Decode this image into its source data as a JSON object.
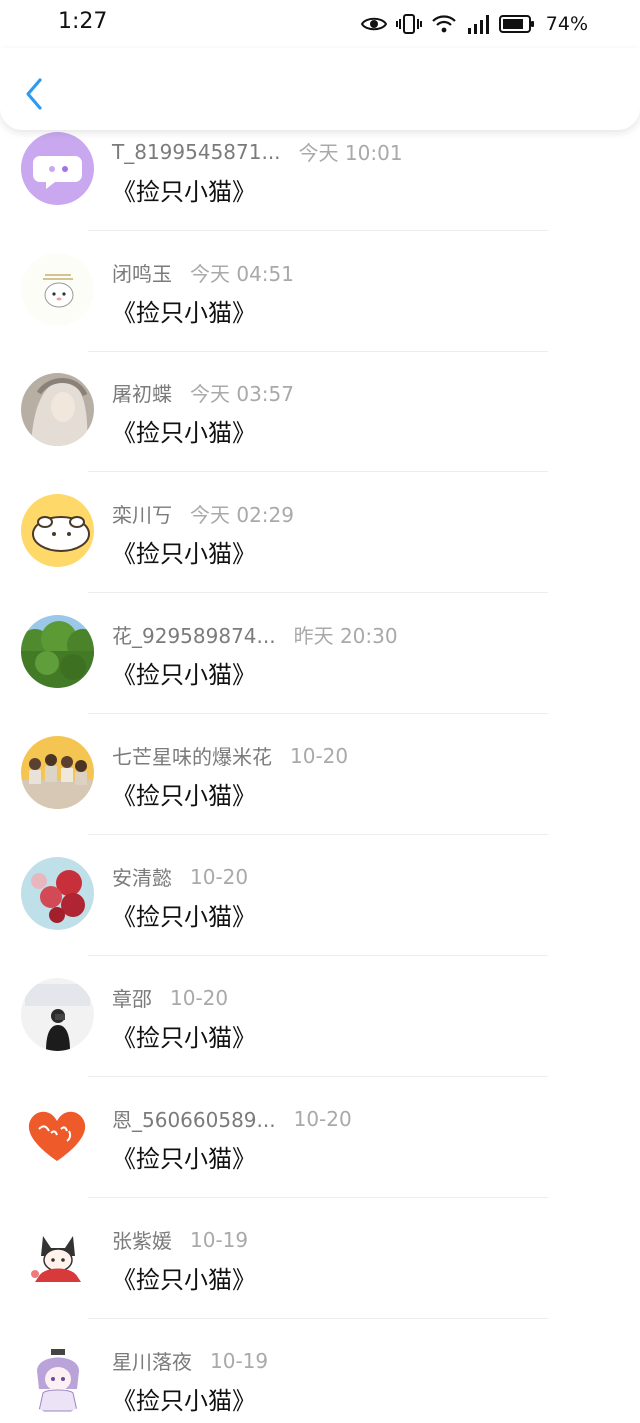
{
  "status_bar": {
    "time": "1:27",
    "battery_percent": "74%"
  },
  "header": {
    "back_icon": "chevron-left-icon"
  },
  "colors": {
    "accent": "#2f9bf0",
    "name": "#7b7b7b",
    "time": "#a9a9a9"
  },
  "items": [
    {
      "name": "T_8199545871...",
      "time": "今天 10:01",
      "message": "《捡只小猫》"
    },
    {
      "name": "闭鸣玉",
      "time": "今天 04:51",
      "message": "《捡只小猫》"
    },
    {
      "name": "屠初蝶",
      "time": "今天 03:57",
      "message": "《捡只小猫》"
    },
    {
      "name": "栾川丂",
      "time": "今天 02:29",
      "message": "《捡只小猫》"
    },
    {
      "name": "花_929589874...",
      "time": "昨天 20:30",
      "message": "《捡只小猫》"
    },
    {
      "name": "七芒星味的爆米花",
      "time": "10-20",
      "message": "《捡只小猫》"
    },
    {
      "name": "安清懿",
      "time": "10-20",
      "message": "《捡只小猫》"
    },
    {
      "name": "章邵",
      "time": "10-20",
      "message": "《捡只小猫》"
    },
    {
      "name": "恩_560660589...",
      "time": "10-20",
      "message": "《捡只小猫》"
    },
    {
      "name": "张紫媛",
      "time": "10-19",
      "message": "《捡只小猫》"
    },
    {
      "name": "星川落夜",
      "time": "10-19",
      "message": "《捡只小猫》"
    }
  ]
}
